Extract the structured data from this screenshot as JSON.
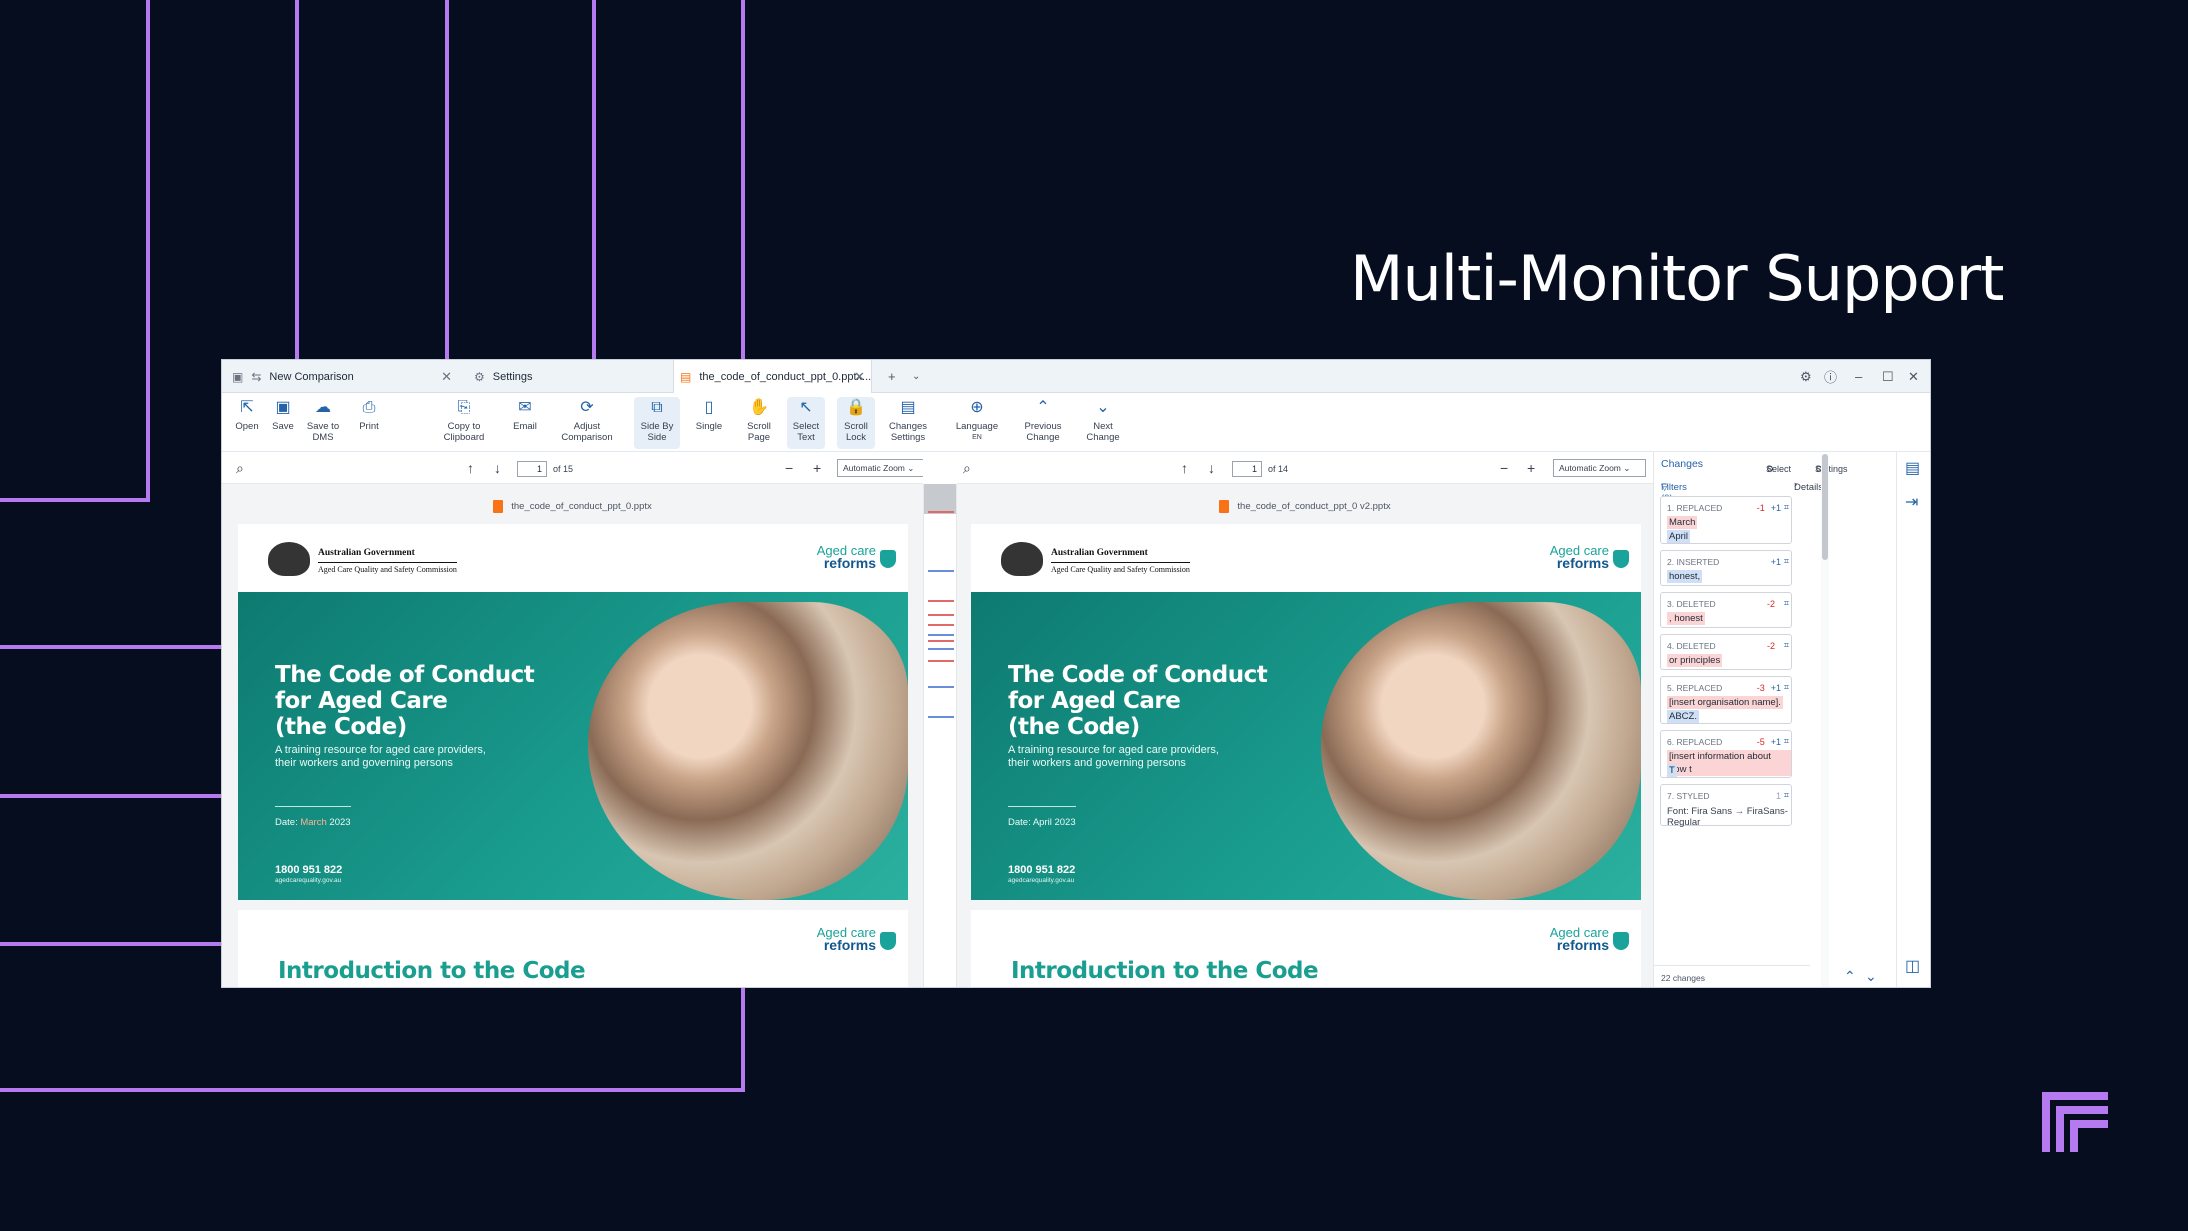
{
  "headline": "Multi-Monitor Support",
  "tabs": [
    {
      "label": "New Comparison",
      "icon": "new-comparison-icon"
    },
    {
      "label": "Settings",
      "icon": "gear-icon"
    },
    {
      "label": "the_code_of_conduct_ppt_0.pptx...",
      "icon": "pptx-file-icon"
    }
  ],
  "toolbar": {
    "open": "Open",
    "save": "Save",
    "save_dms": "Save to DMS",
    "print": "Print",
    "copy": "Copy to Clipboard",
    "email": "Email",
    "adjust": "Adjust Comparison",
    "side": "Side By Side",
    "single": "Single",
    "scroll": "Scroll Page",
    "select": "Select Text",
    "lock": "Scroll Lock",
    "changes_settings": "Changes Settings",
    "language": "Language",
    "language_code": "EN",
    "prev": "Previous Change",
    "next": "Next Change"
  },
  "left_pane": {
    "page": "1",
    "of": "of 15",
    "zoom": "Automatic Zoom",
    "file": "the_code_of_conduct_ppt_0.pptx",
    "date_prefix": "Date: ",
    "date_month": "March",
    "date_year": " 2023"
  },
  "right_pane": {
    "page": "1",
    "of": "of 14",
    "zoom": "Automatic Zoom",
    "file": "the_code_of_conduct_ppt_0 v2.pptx",
    "date": "Date: April 2023"
  },
  "slide": {
    "gov1": "Australian Government",
    "gov2": "Aged Care Quality and Safety Commission",
    "brand1": "Aged care",
    "brand2": "reforms",
    "title": "The Code of Conduct\nfor Aged Care\n(the Code)",
    "subtitle": "A training resource for aged care providers, their workers and governing persons",
    "phone": "1800 951 822",
    "url": "agedcarequality.gov.au",
    "intro": "Introduction to the Code"
  },
  "changes": {
    "title": "Changes",
    "select": "Select",
    "settings": "Settings",
    "filters": "Filters (0)",
    "details": "Details",
    "items": [
      {
        "head": "1. REPLACED",
        "neg": "-1",
        "pos": "+1",
        "removed": "March",
        "added": "April"
      },
      {
        "head": "2. INSERTED",
        "pos": "+1",
        "added": "honest,"
      },
      {
        "head": "3. DELETED",
        "neg": "-2",
        "removed": ", honest"
      },
      {
        "head": "4. DELETED",
        "neg": "-2",
        "removed": "or principles"
      },
      {
        "head": "5. REPLACED",
        "neg": "-3",
        "pos": "+1",
        "removed": "[insert organisation name].",
        "added": "ABCZ."
      },
      {
        "head": "6. REPLACED",
        "neg": "-5",
        "pos": "+1",
        "removed": "[insert information about how t",
        "added": "T"
      },
      {
        "head": "7. STYLED",
        "count": "1",
        "style_label": "Font: ",
        "style_from": "Fira Sans",
        "arrow": "→",
        "style_to": "FiraSans-Regular"
      }
    ],
    "footer": "22 changes"
  },
  "colors": {
    "background": "#050d1f",
    "accent": "#b57af0",
    "teal": "#1a9e90",
    "link": "#2563a8"
  }
}
